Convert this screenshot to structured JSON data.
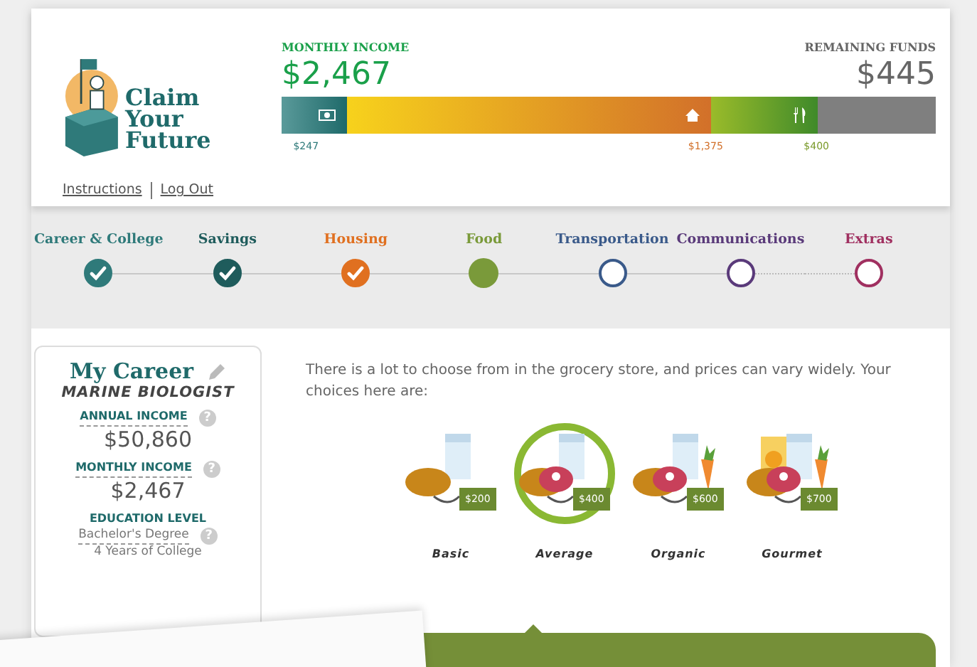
{
  "logo": {
    "line_1": "Claim",
    "line_2": "Your",
    "line_3": "Future"
  },
  "header_links": [
    "Instructions",
    "Log Out"
  ],
  "monthly_income": {
    "label": "MONTHLY INCOME",
    "value": "$2,467"
  },
  "remaining_funds": {
    "label": "REMAINING FUNDS",
    "value": "$445"
  },
  "budget_bar": [
    {
      "kind": "savings",
      "amount": "$247"
    },
    {
      "kind": "housing",
      "amount": "$1,375"
    },
    {
      "kind": "food",
      "amount": "$400"
    },
    {
      "kind": "remaining"
    }
  ],
  "steps": [
    {
      "label": "Career & College",
      "color": "#2f7a7a",
      "checked": true,
      "selected": false,
      "optional": false
    },
    {
      "label": "Savings",
      "color": "#1f5c5c",
      "checked": true,
      "selected": false,
      "optional": false
    },
    {
      "label": "Housing",
      "color": "#e07020",
      "checked": true,
      "selected": false,
      "optional": false
    },
    {
      "label": "Food",
      "color": "#7a9a3a",
      "checked": false,
      "selected": true,
      "optional": false
    },
    {
      "label": "Transportation",
      "color": "#3a5a8a",
      "checked": false,
      "selected": false,
      "optional": false
    },
    {
      "label": "Communications",
      "color": "#5a3a7a",
      "checked": false,
      "selected": false,
      "optional": false
    },
    {
      "label": "Extras",
      "color": "#a03060",
      "checked": false,
      "selected": false,
      "optional": true
    }
  ],
  "career": {
    "title": "My Career",
    "job": "MARINE BIOLOGIST",
    "annual_income": {
      "label": "ANNUAL INCOME",
      "help": "?",
      "value": "$50,860"
    },
    "monthly_income": {
      "label": "MONTHLY INCOME",
      "help": "?",
      "value": "$2,467"
    },
    "education": {
      "label": "EDUCATION LEVEL",
      "degree": "Bachelor's Degree",
      "help": "?",
      "detail": "4 Years of College"
    }
  },
  "intro": "There is a lot to choose from in the grocery store, and prices can vary widely.  Your choices here are:",
  "food_options": [
    {
      "kind": "basic",
      "label": "Basic",
      "price": "$200",
      "selected": false
    },
    {
      "kind": "average",
      "label": "Average",
      "price": "$400",
      "selected": true
    },
    {
      "kind": "organic",
      "label": "Organic",
      "price": "$600",
      "selected": false
    },
    {
      "kind": "gourmet",
      "label": "Gourmet",
      "price": "$700",
      "selected": false
    }
  ]
}
